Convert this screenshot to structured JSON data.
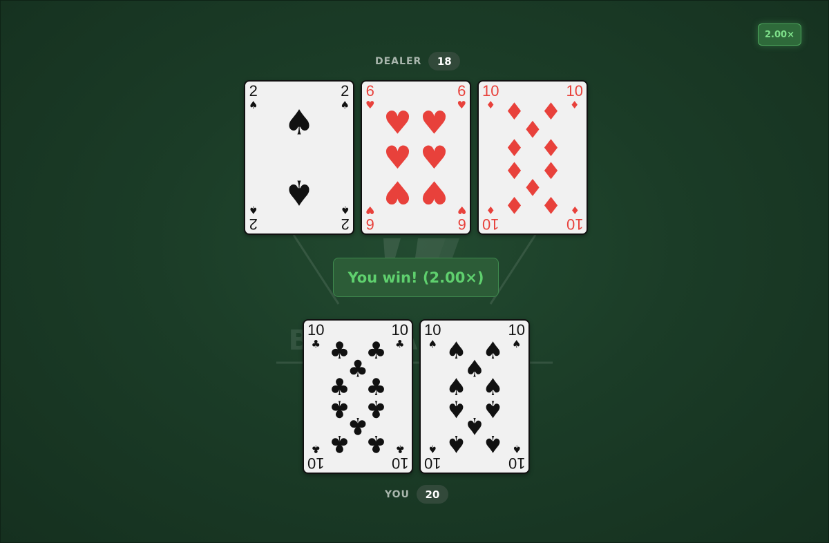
{
  "multiplier": "2.00×",
  "dealer": {
    "label": "DEALER",
    "score": "18",
    "cards": [
      {
        "rank": "2",
        "suit": "♠",
        "suit_name": "spades",
        "color": "#111111"
      },
      {
        "rank": "6",
        "suit": "♥",
        "suit_name": "hearts",
        "color": "#e8413b"
      },
      {
        "rank": "10",
        "suit": "♦",
        "suit_name": "diamonds",
        "color": "#e8413b"
      }
    ]
  },
  "result_text": "You win! (2.00×)",
  "player": {
    "label": "YOU",
    "score": "20",
    "cards": [
      {
        "rank": "10",
        "suit": "♣",
        "suit_name": "clubs",
        "color": "#111111"
      },
      {
        "rank": "10",
        "suit": "♠",
        "suit_name": "spades",
        "color": "#111111"
      }
    ]
  },
  "watermark_icon": "table-logo-icon"
}
